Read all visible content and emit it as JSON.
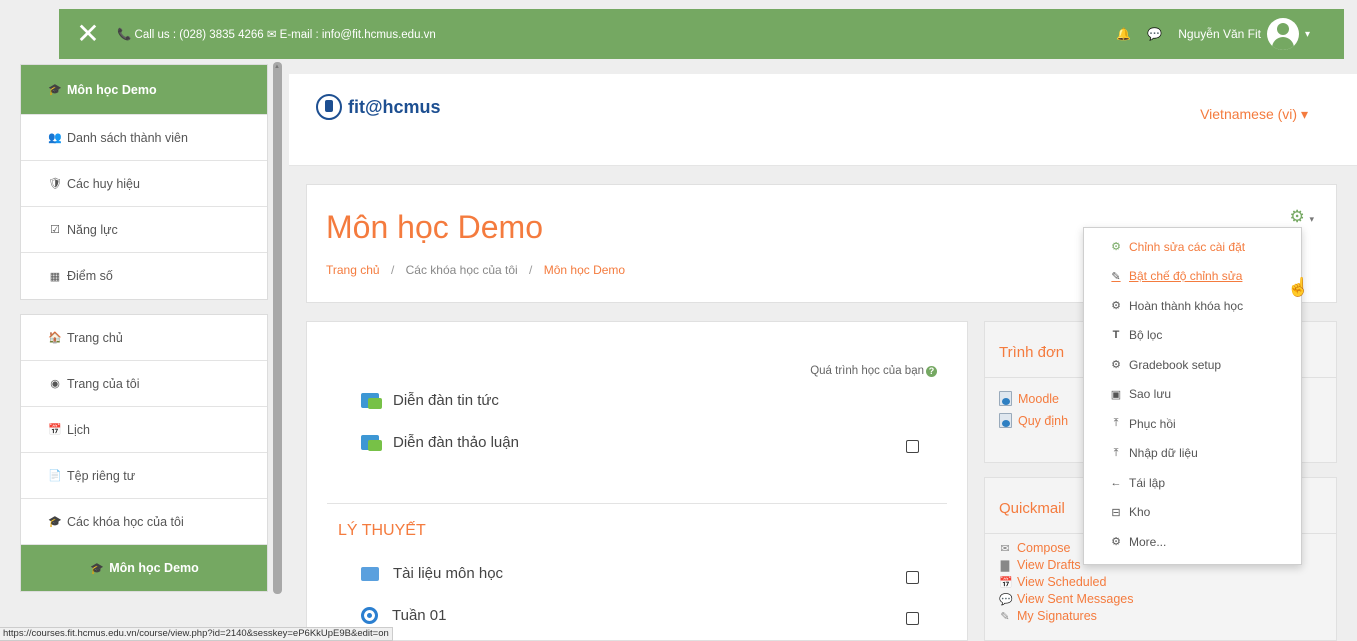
{
  "topbar": {
    "close_icon": "✕",
    "contact": "📞 Call us : (028) 3835 4266 ✉ E-mail : info@fit.hcmus.edu.vn",
    "bell_icon": "🔔",
    "chat_icon": "💬",
    "user_name": "Nguyễn Văn Fit",
    "caret": "▾"
  },
  "sidebar": {
    "group1": [
      {
        "icon": "🎓",
        "label": "Môn học Demo"
      },
      {
        "icon": "👥",
        "label": "Danh sách thành viên"
      },
      {
        "icon": "🛡",
        "label": "Các huy hiệu"
      },
      {
        "icon": "☑",
        "label": "Năng lực"
      },
      {
        "icon": "▦",
        "label": "Điểm số"
      }
    ],
    "group2": [
      {
        "icon": "🏠",
        "label": "Trang chủ"
      },
      {
        "icon": "◉",
        "label": "Trang của tôi"
      },
      {
        "icon": "📅",
        "label": "Lịch"
      },
      {
        "icon": "📄",
        "label": "Tệp riêng tư"
      },
      {
        "icon": "🎓",
        "label": "Các khóa học của tôi"
      },
      {
        "icon": "🎓",
        "label": "Môn học Demo"
      }
    ]
  },
  "header": {
    "logo_text": "fit@hcmus",
    "language": "Vietnamese (vi) ▾"
  },
  "course": {
    "title": "Môn học Demo",
    "breadcrumb": [
      "Trang chủ",
      "Các khóa học của tôi",
      "Môn học Demo"
    ],
    "gear_icon": "⚙",
    "gear_caret": "▾"
  },
  "content": {
    "progress_label": "Quá trình học của bạn",
    "help_icon": "?",
    "items_top": [
      "Diễn đàn tin tức",
      "Diễn đàn thảo luận"
    ],
    "section_title": "LÝ THUYẾT",
    "items_section": [
      "Tài liệu môn học",
      "Tuần 01"
    ]
  },
  "block_menu": {
    "title": "Trình đơn",
    "links": [
      "Moodle",
      "Quy định"
    ]
  },
  "block_quickmail": {
    "title": "Quickmail",
    "links": [
      {
        "icon": "✉",
        "label": "Compose"
      },
      {
        "icon": "▇",
        "label": "View Drafts"
      },
      {
        "icon": "📅",
        "label": "View Scheduled"
      },
      {
        "icon": "💬",
        "label": "View Sent Messages"
      },
      {
        "icon": "✎",
        "label": "My Signatures"
      }
    ]
  },
  "admin_menu": [
    {
      "icon": "⚙",
      "label": "Chỉnh sửa các cài đặt",
      "style": "highlight"
    },
    {
      "icon": "✎",
      "label": "Bật chế độ chỉnh sửa",
      "style": "hover"
    },
    {
      "icon": "⚙",
      "label": "Hoàn thành khóa học",
      "style": ""
    },
    {
      "icon": "T",
      "label": "Bộ lọc",
      "style": ""
    },
    {
      "icon": "⚙",
      "label": "Gradebook setup",
      "style": ""
    },
    {
      "icon": "▣",
      "label": "Sao lưu",
      "style": ""
    },
    {
      "icon": "⤒",
      "label": "Phục hồi",
      "style": ""
    },
    {
      "icon": "⤒",
      "label": "Nhập dữ liệu",
      "style": ""
    },
    {
      "icon": "←",
      "label": "Tái lập",
      "style": ""
    },
    {
      "icon": "⊟",
      "label": "Kho",
      "style": ""
    },
    {
      "icon": "⚙",
      "label": "More...",
      "style": ""
    }
  ],
  "statusbar": {
    "url": "https://courses.fit.hcmus.edu.vn/course/view.php?id=2140&sesskey=eP6KkUpE9B&edit=on"
  },
  "colors": {
    "brand_green": "#75a862",
    "accent_orange": "#f47b3e",
    "logo_blue": "#1d4f91"
  }
}
